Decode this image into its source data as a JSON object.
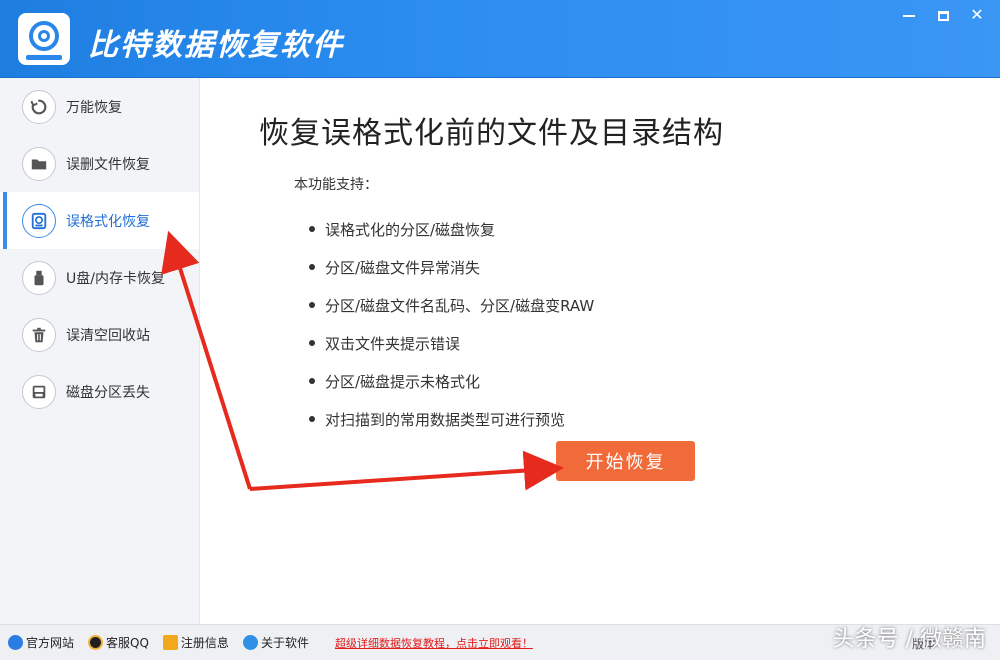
{
  "app": {
    "title": "比特数据恢复软件"
  },
  "window_controls": {
    "close_glyph": "✕"
  },
  "sidebar": {
    "items": [
      {
        "label": "万能恢复",
        "icon": "undo-circle-icon"
      },
      {
        "label": "误删文件恢复",
        "icon": "folder-icon"
      },
      {
        "label": "误格式化恢复",
        "icon": "format-disk-icon"
      },
      {
        "label": "U盘/内存卡恢复",
        "icon": "usb-drive-icon"
      },
      {
        "label": "误清空回收站",
        "icon": "trash-icon"
      },
      {
        "label": "磁盘分区丢失",
        "icon": "disk-partition-icon"
      }
    ],
    "active_index": 2
  },
  "main": {
    "headline": "恢复误格式化前的文件及目录结构",
    "support_title": "本功能支持：",
    "features": [
      "误格式化的分区/磁盘恢复",
      "分区/磁盘文件异常消失",
      "分区/磁盘文件名乱码、分区/磁盘变RAW",
      "双击文件夹提示错误",
      "分区/磁盘提示未格式化",
      "对扫描到的常用数据类型可进行预览"
    ],
    "start_button": "开始恢复"
  },
  "footer": {
    "links": [
      {
        "label": "官方网站",
        "icon": "ie-globe-icon",
        "color": "#2a7de1"
      },
      {
        "label": "客服QQ",
        "icon": "qq-penguin-icon",
        "color": "#1f1f1f"
      },
      {
        "label": "注册信息",
        "icon": "pencil-icon",
        "color": "#f2a81d"
      },
      {
        "label": "关于软件",
        "icon": "info-globe-icon",
        "color": "#2f90e6"
      }
    ],
    "promo": "超级详细数据恢复教程，点击立即观看！",
    "version": "版本"
  },
  "watermark": "头条号 / 微赣南",
  "colors": {
    "title_bar": "#2b8cf0",
    "accent": "#1f6fd6",
    "start_button": "#f06a3a",
    "annotation_arrow": "#e62a1e",
    "promo": "#e21b1b"
  }
}
